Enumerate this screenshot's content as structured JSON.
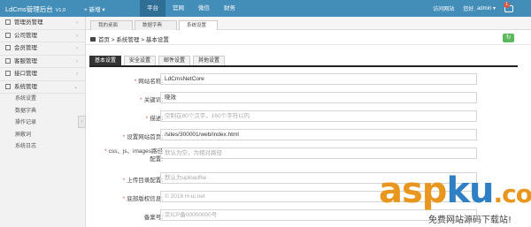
{
  "app": {
    "title": "LdCms管理后台",
    "version": "V1.0",
    "new_label": "+ 新增 ▾"
  },
  "nav": [
    {
      "label": "平台"
    },
    {
      "label": "官网"
    },
    {
      "label": "微信"
    },
    {
      "label": "财务"
    }
  ],
  "topright": {
    "visit": "访问网站",
    "greeting": "您好,",
    "user": "admin ▾",
    "badge": "1"
  },
  "sidebar": {
    "items": [
      {
        "label": "管理员管理"
      },
      {
        "label": "公司管理"
      },
      {
        "label": "会员管理"
      },
      {
        "label": "客服管理"
      },
      {
        "label": "接口管理"
      },
      {
        "label": "系统管理"
      }
    ],
    "subitems": [
      {
        "label": "系统设置"
      },
      {
        "label": "数据字典"
      },
      {
        "label": "操作记录"
      },
      {
        "label": "屏蔽词"
      },
      {
        "label": "系统日志"
      }
    ]
  },
  "tabs": [
    {
      "label": "我的桌面"
    },
    {
      "label": "数据字典"
    },
    {
      "label": "系统设置"
    }
  ],
  "breadcrumb": "首页 > 系统管理 > 基本设置",
  "settings_tabs": [
    {
      "label": "基本设置"
    },
    {
      "label": "安全设置"
    },
    {
      "label": "邮件设置"
    },
    {
      "label": "其他设置"
    }
  ],
  "form": {
    "site_name": {
      "label": "网站名称:",
      "value": "LdCmsNetCore"
    },
    "keywords": {
      "label": "关键词:",
      "value": "晓效"
    },
    "description": {
      "label": "描述:",
      "placeholder": "空制在80个汉字，160个字符以内"
    },
    "home_path": {
      "label": "设置网站首页:",
      "value": "/sites/300001/web/index.html"
    },
    "asset_path": {
      "label_line1": "css、js、images路径",
      "label_line2": "配置:",
      "placeholder": "默认为空，为相对路径"
    },
    "upload_dir": {
      "label": "上传目录配置:",
      "placeholder": "默认为uploadfile"
    },
    "copyright": {
      "label": "底部版权信息:",
      "placeholder": "© 2016 H-ui.net"
    },
    "icp": {
      "label": "备案号:",
      "placeholder": "京ICP备00000000号"
    }
  },
  "watermark": {
    "logo_a": "asp",
    "logo_b": "ku",
    "logo_c": ".com",
    "tagline": "免费网站源码下载站!"
  }
}
